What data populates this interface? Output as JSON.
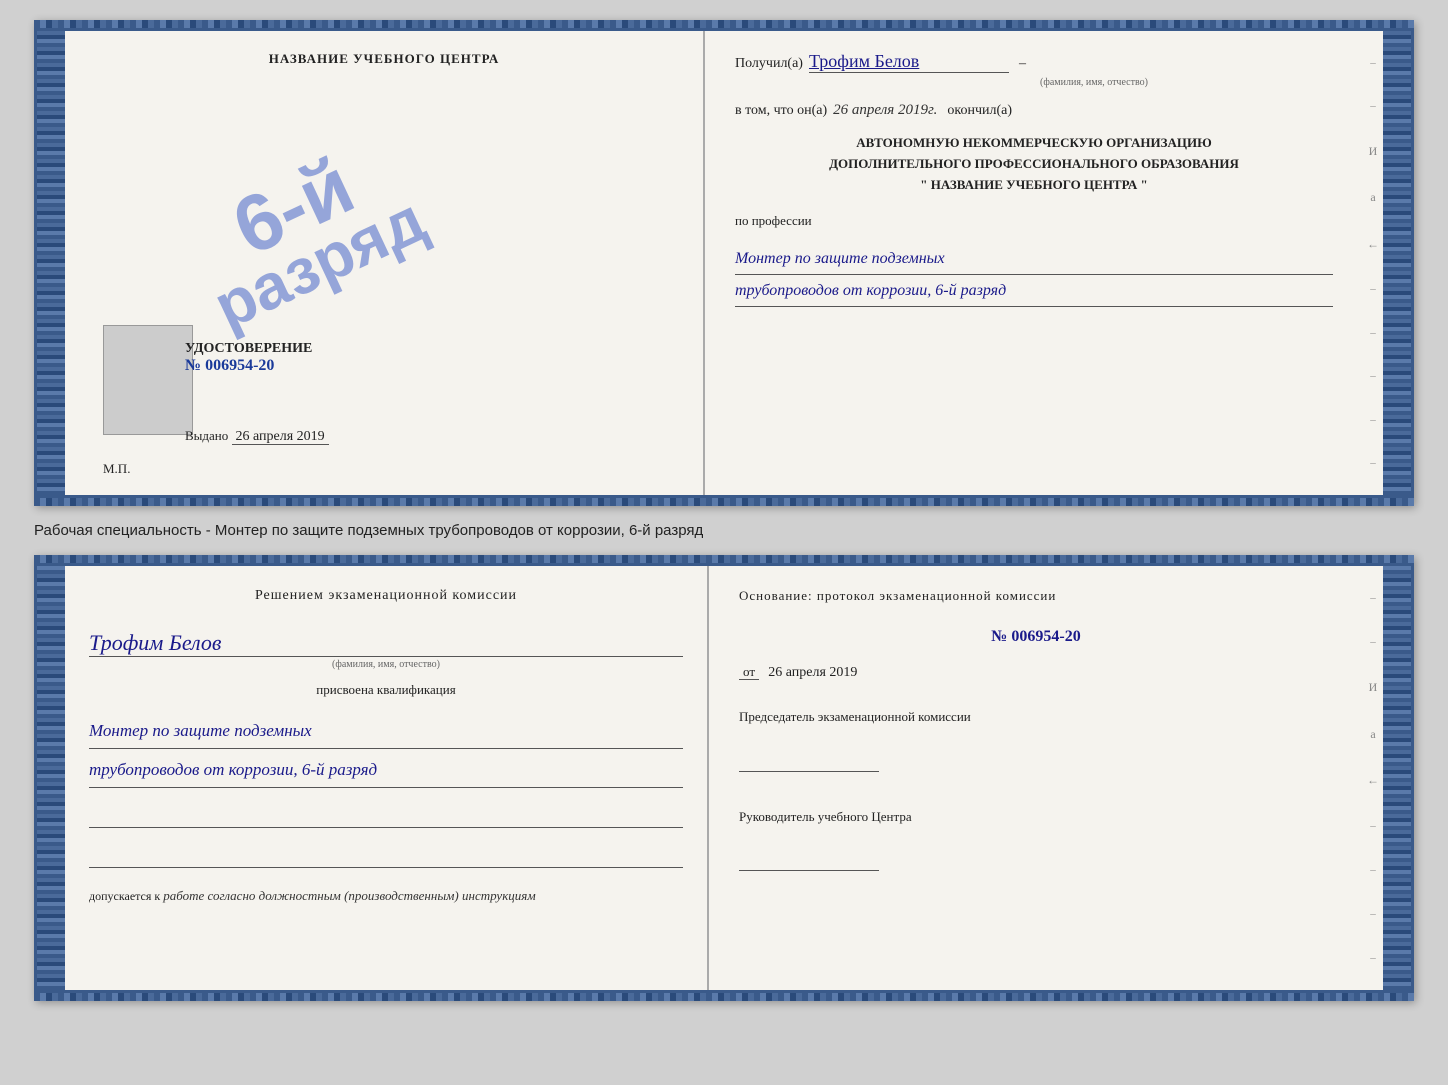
{
  "page": {
    "background": "#d0d0d0"
  },
  "cert_top": {
    "left": {
      "school_name_label": "НАЗВАНИЕ УЧЕБНОГО ЦЕНТРА",
      "stamp_line1": "6-й",
      "stamp_line2": "разряд",
      "udostoverenie_label": "УДОСТОВЕРЕНИЕ",
      "udostoverenie_num": "№ 006954-20",
      "vydano_label": "Выдано",
      "vydano_date": "26 апреля 2019",
      "mp_label": "М.П."
    },
    "right": {
      "poluchil_label": "Получил(а)",
      "poluchil_name": "Трофим Белов",
      "fio_sublabel": "(фамилия, имя, отчество)",
      "dash1": "–",
      "vtom_label": "в том, что он(а)",
      "vtom_date": "26 апреля 2019г.",
      "okonchill_label": "окончил(а)",
      "org_line1": "АВТОНОМНУЮ НЕКОММЕРЧЕСКУЮ ОРГАНИЗАЦИЮ",
      "org_line2": "ДОПОЛНИТЕЛЬНОГО ПРОФЕССИОНАЛЬНОГО ОБРАЗОВАНИЯ",
      "org_line3": "\" НАЗВАНИЕ УЧЕБНОГО ЦЕНТРА \"",
      "po_professii_label": "по профессии",
      "profession_line1": "Монтер по защите подземных",
      "profession_line2": "трубопроводов от коррозии, 6-й разряд"
    }
  },
  "middle_text": "Рабочая специальность - Монтер по защите подземных трубопроводов от коррозии, 6-й разряд",
  "cert_bottom": {
    "left": {
      "resheniem_label": "Решением  экзаменационной  комиссии",
      "name": "Трофим Белов",
      "fio_sublabel": "(фамилия, имя, отчество)",
      "prisvoena_label": "присвоена квалификация",
      "qualification_line1": "Монтер по защите подземных",
      "qualification_line2": "трубопроводов от коррозии, 6-й разряд",
      "dopuskaetsya_label": "допускается к",
      "dopusk_text": "работе согласно должностным (производственным) инструкциям"
    },
    "right": {
      "osnovanie_label": "Основание: протокол экзаменационной  комиссии",
      "protocol_num": "№  006954-20",
      "ot_label": "от",
      "ot_date": "26 апреля 2019",
      "predsedatel_label": "Председатель экзаменационной комиссии",
      "rukovoditel_label": "Руководитель учебного Центра"
    }
  },
  "side_chars": {
    "chars": [
      "И",
      "а",
      "←",
      "–",
      "–",
      "–",
      "–",
      "–"
    ]
  }
}
